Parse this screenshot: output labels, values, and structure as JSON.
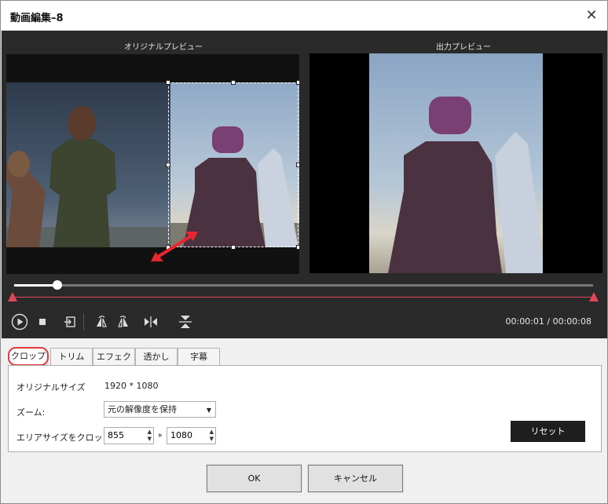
{
  "window": {
    "title": "動画編集–8",
    "close_label": "✕"
  },
  "preview": {
    "original_label": "オリジナルプレビュー",
    "output_label": "出力プレビュー"
  },
  "playback": {
    "current_time": "00:00:01",
    "total_time": "00:00:08",
    "time_display": "00:00:01 / 00:00:08",
    "progress": 0.075,
    "trim_start": 0.0,
    "trim_end": 1.0
  },
  "controls": {
    "icons": [
      "play-icon",
      "stop-icon",
      "snapshot-icon",
      "rotate-left-icon",
      "rotate-right-icon",
      "flip-horizontal-icon",
      "flip-vertical-icon"
    ]
  },
  "tabs": [
    {
      "label": "クロップ",
      "active": true
    },
    {
      "label": "トリム",
      "active": false
    },
    {
      "label": "エフェクト",
      "active": false
    },
    {
      "label": "透かし",
      "active": false
    },
    {
      "label": "字幕",
      "active": false
    }
  ],
  "crop": {
    "original_size_label": "オリジナルサイズ",
    "original_size_value": "1920 * 1080",
    "zoom_label": "ズーム:",
    "zoom_value": "元の解像度を保持",
    "area_label": "エリアサイズをクロップ:",
    "width_value": "855",
    "separator": "*",
    "height_value": "1080",
    "reset_label": "リセット"
  },
  "buttons": {
    "ok": "OK",
    "cancel": "キャンセル"
  },
  "colors": {
    "accent_red": "#e0475a",
    "tab_highlight": "#e23a3a",
    "editor_bg": "#2a2a2a",
    "arrow_red": "#e8262e"
  }
}
